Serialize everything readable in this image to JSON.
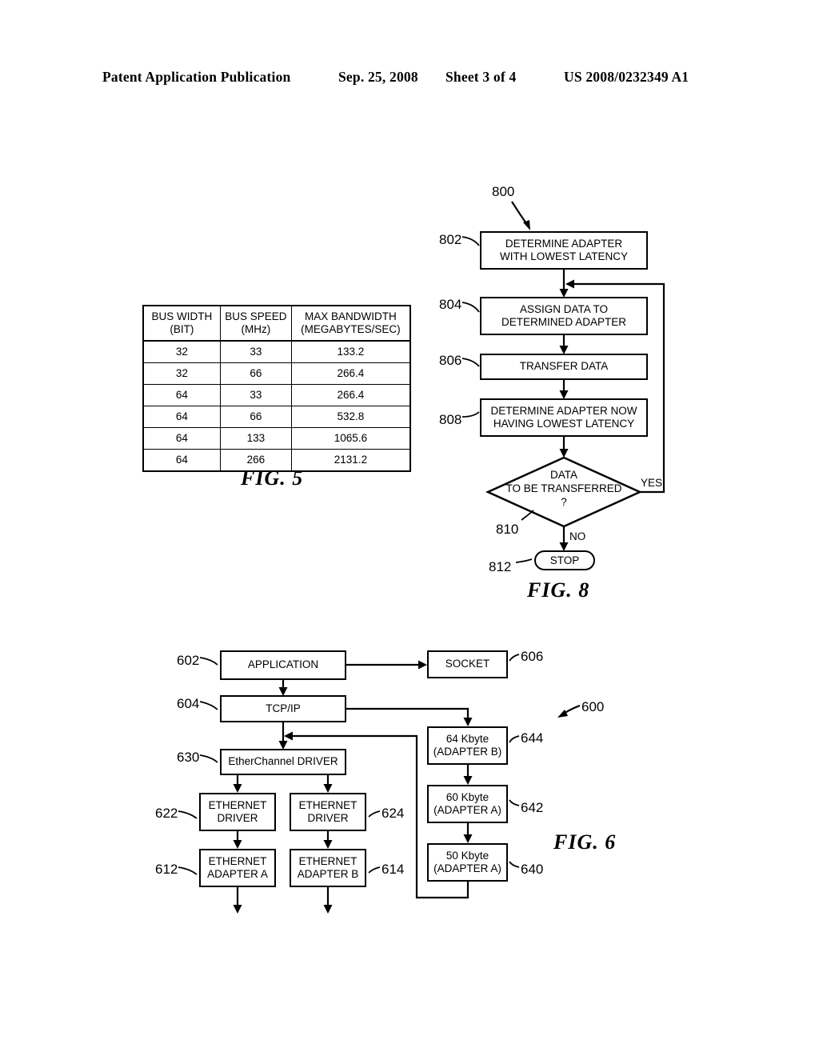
{
  "header": {
    "left": "Patent Application Publication",
    "date": "Sep. 25, 2008",
    "sheet": "Sheet 3 of 4",
    "patent_number": "US 2008/0232349 A1"
  },
  "fig5": {
    "caption": "FIG. 5",
    "columns": [
      "BUS WIDTH\n(BIT)",
      "BUS SPEED\n(MHz)",
      "MAX BANDWIDTH\n(MEGABYTES/SEC)"
    ],
    "rows": [
      [
        "32",
        "33",
        "133.2"
      ],
      [
        "32",
        "66",
        "266.4"
      ],
      [
        "64",
        "33",
        "266.4"
      ],
      [
        "64",
        "66",
        "532.8"
      ],
      [
        "64",
        "133",
        "1065.6"
      ],
      [
        "64",
        "266",
        "2131.2"
      ]
    ]
  },
  "fig8": {
    "caption": "FIG. 8",
    "figure_ref": "800",
    "steps": [
      {
        "ref": "802",
        "label": "DETERMINE ADAPTER\nWITH LOWEST LATENCY"
      },
      {
        "ref": "804",
        "label": "ASSIGN DATA TO\nDETERMINED ADAPTER"
      },
      {
        "ref": "806",
        "label": "TRANSFER DATA"
      },
      {
        "ref": "808",
        "label": "DETERMINE ADAPTER NOW\nHAVING LOWEST LATENCY"
      }
    ],
    "decision": {
      "ref": "810",
      "label": "DATA\nTO BE TRANSFERRED\n?",
      "yes_label": "YES",
      "no_label": "NO"
    },
    "terminator": {
      "ref": "812",
      "label": "STOP"
    }
  },
  "fig6": {
    "caption": "FIG. 6",
    "figure_ref": "600",
    "blocks": [
      {
        "ref": "602",
        "label": "APPLICATION"
      },
      {
        "ref": "604",
        "label": "TCP/IP"
      },
      {
        "ref": "606",
        "label": "SOCKET"
      },
      {
        "ref": "630",
        "label": "EtherChannel DRIVER"
      },
      {
        "ref": "622",
        "label": "ETHERNET\nDRIVER"
      },
      {
        "ref": "624",
        "label": "ETHERNET\nDRIVER"
      },
      {
        "ref": "612",
        "label": "ETHERNET\nADAPTER A"
      },
      {
        "ref": "614",
        "label": "ETHERNET\nADAPTER B"
      },
      {
        "ref": "644",
        "label": "64 Kbyte\n(ADAPTER B)"
      },
      {
        "ref": "642",
        "label": "60 Kbyte\n(ADAPTER A)"
      },
      {
        "ref": "640",
        "label": "50 Kbyte\n(ADAPTER A)"
      }
    ]
  }
}
